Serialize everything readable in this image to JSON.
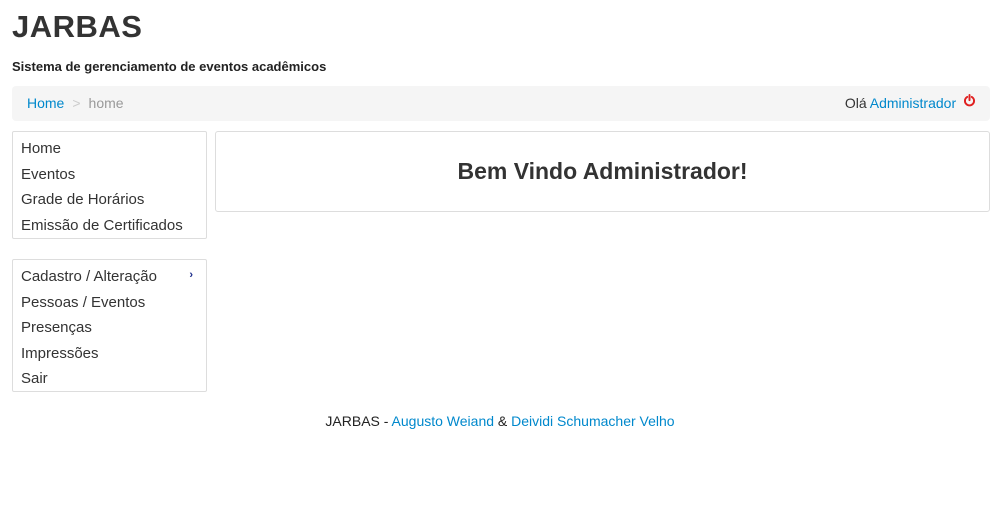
{
  "header": {
    "title": "JARBAS",
    "subtitle": "Sistema de gerenciamento de eventos acadêmicos"
  },
  "breadcrumb": {
    "home_label": "Home",
    "separator": ">",
    "current": "home"
  },
  "user": {
    "greeting": "Olá",
    "name": "Administrador",
    "logout_icon": "power-icon",
    "logout_color": "#e02020"
  },
  "sidebar": {
    "menu1": [
      {
        "label": "Home"
      },
      {
        "label": "Eventos"
      },
      {
        "label": "Grade de Horários"
      },
      {
        "label": "Emissão de Certificados"
      }
    ],
    "menu2": [
      {
        "label": "Cadastro / Alteração",
        "icon": "chevron-right-icon",
        "chevron": "›"
      },
      {
        "label": "Pessoas / Eventos"
      },
      {
        "label": "Presenças"
      },
      {
        "label": "Impressões"
      },
      {
        "label": "Sair"
      }
    ]
  },
  "main": {
    "welcome": "Bem Vindo Administrador!"
  },
  "footer": {
    "app": "JARBAS",
    "dash": " - ",
    "author1": "Augusto Weiand",
    "amp": " & ",
    "author2": "Deividi Schumacher Velho"
  },
  "colors": {
    "link": "#0088cc",
    "breadcrumb_bg": "#f5f5f5",
    "border": "#dddddd",
    "text": "#333333"
  }
}
